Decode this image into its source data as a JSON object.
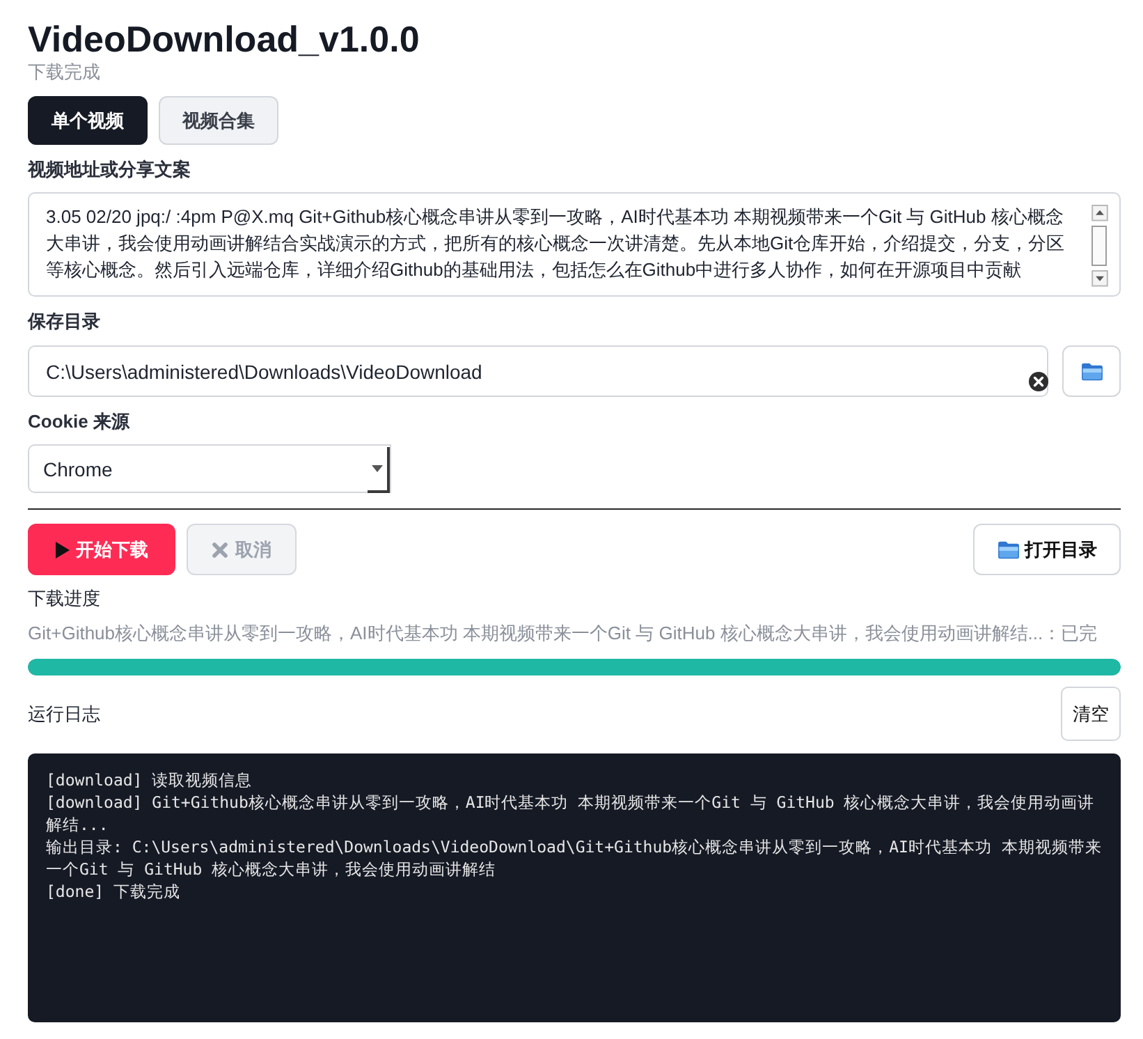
{
  "header": {
    "title": "VideoDownload_v1.0.0",
    "status": "下载完成"
  },
  "tabs": [
    {
      "label": "单个视频",
      "selected": true
    },
    {
      "label": "视频合集",
      "selected": false
    }
  ],
  "url_field": {
    "label": "视频地址或分享文案",
    "value": "3.05 02/20 jpq:/ :4pm P@X.mq Git+Github核心概念串讲从零到一攻略，AI时代基本功 本期视频带来一个Git 与 GitHub 核心概念大串讲，我会使用动画讲解结合实战演示的方式，把所有的核心概念一次讲清楚。先从本地Git仓库开始，介绍提交，分支，分区等核心概念。然后引入远端仓库，详细介绍Github的基础用法，包括怎么在Github中进行多人协作，如何在开源项目中贡献"
  },
  "save_dir": {
    "label": "保存目录",
    "value": "C:\\Users\\administered\\Downloads\\VideoDownload"
  },
  "cookie_source": {
    "label": "Cookie 来源",
    "value": "Chrome"
  },
  "actions": [
    {
      "kind": "start",
      "label": "开始下载",
      "disabled": false
    },
    {
      "kind": "cancel",
      "label": "取消",
      "disabled": true
    },
    {
      "kind": "open",
      "label": "打开目录",
      "disabled": false
    }
  ],
  "progress": {
    "label": "下载进度",
    "text": "Git+Github核心概念串讲从零到一攻略，AI时代基本功 本期视频带来一个Git 与 GitHub 核心概念大串讲，我会使用动画讲解结...：已完",
    "level": 1
  },
  "log": {
    "label": "运行日志",
    "clear_label": "清空",
    "lines": [
      "[download] 读取视频信息",
      "[download] Git+Github核心概念串讲从零到一攻略，AI时代基本功 本期视频带来一个Git 与 GitHub 核心概念大串讲，我会使用动画讲解结...",
      "输出目录: C:\\Users\\administered\\Downloads\\VideoDownload\\Git+Github核心概念串讲从零到一攻略，AI时代基本功 本期视频带来一个Git 与 GitHub 核心概念大串讲，我会使用动画讲解结",
      "[done] 下载完成"
    ]
  }
}
